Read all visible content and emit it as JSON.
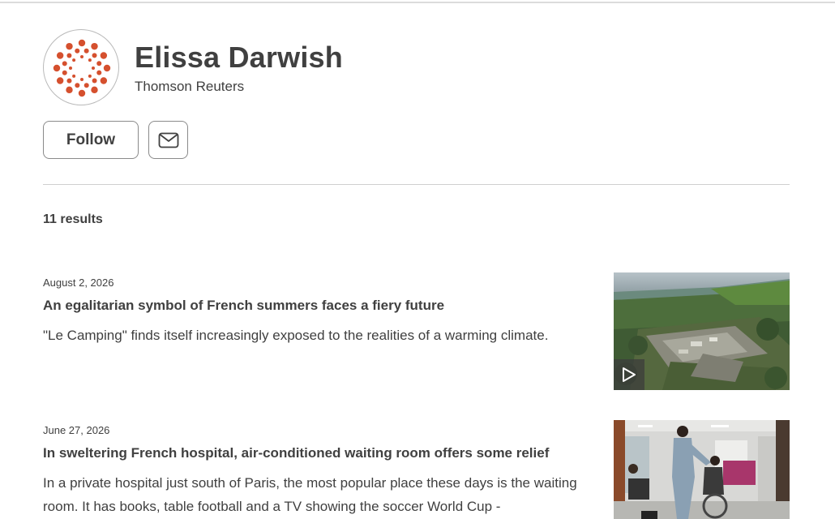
{
  "author": {
    "name": "Elissa Darwish",
    "organization": "Thomson Reuters",
    "avatar_icon": "reuters-logo-icon",
    "brand_color": "#d5502e"
  },
  "actions": {
    "follow_label": "Follow",
    "email_icon": "envelope-icon"
  },
  "results": {
    "count_label": "11 results"
  },
  "stories": [
    {
      "date": "August 2, 2026",
      "title": "An egalitarian symbol of French summers faces a fiery future",
      "description": "\"Le Camping\" finds itself increasingly exposed to the realities of a warming climate.",
      "has_video": true
    },
    {
      "date": "June 27, 2026",
      "title": "In sweltering French hospital, air-conditioned waiting room offers some relief",
      "description": "In a private hospital just south of Paris, the most popular place these days is the waiting room. It has books, table football and a TV showing the soccer World Cup -",
      "has_video": false
    }
  ]
}
